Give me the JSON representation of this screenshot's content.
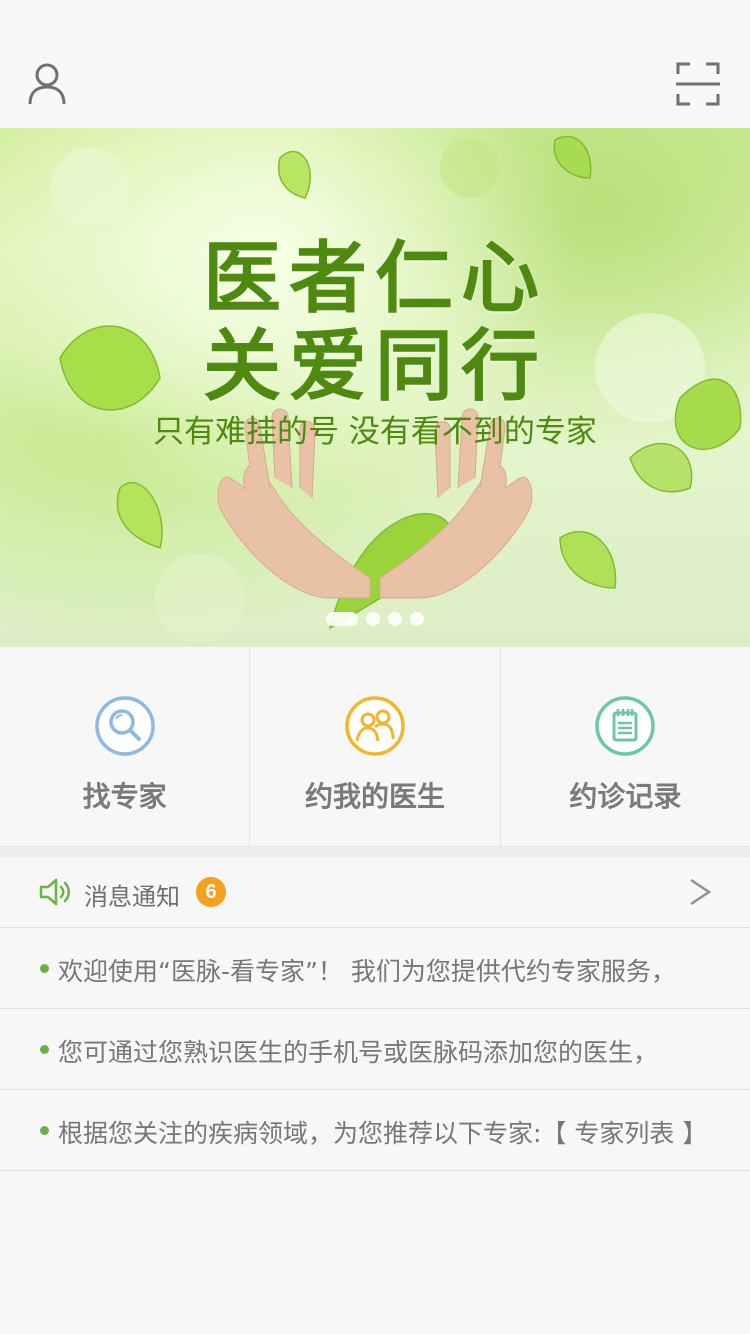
{
  "header": {
    "profile_icon": "user-icon",
    "scan_icon": "scan-icon"
  },
  "banner": {
    "title_line1": "医者仁心",
    "title_line2": "关爱同行",
    "subtitle": "只有难挂的号 没有看不到的专家",
    "slide_count": 4,
    "active_slide": 1
  },
  "actions": [
    {
      "label": "找专家",
      "icon": "search-icon",
      "color": "#8fb8e2"
    },
    {
      "label": "约我的医生",
      "icon": "doctors-icon",
      "color": "#f2b62d"
    },
    {
      "label": "约诊记录",
      "icon": "notepad-icon",
      "color": "#6cc7a6"
    }
  ],
  "notices": {
    "title": "消息通知",
    "count": "6",
    "items": [
      "欢迎使用“医脉-看专家”！ 我们为您提供代约专家服务，",
      "您可通过您熟识医生的手机号或医脉码添加您的医生，",
      "根据您关注的疾病领域，为您推荐以下专家:【 专家列表 】"
    ]
  },
  "colors": {
    "accent_green": "#67b443",
    "banner_text": "#4f8a10",
    "badge": "#f4a21c"
  }
}
